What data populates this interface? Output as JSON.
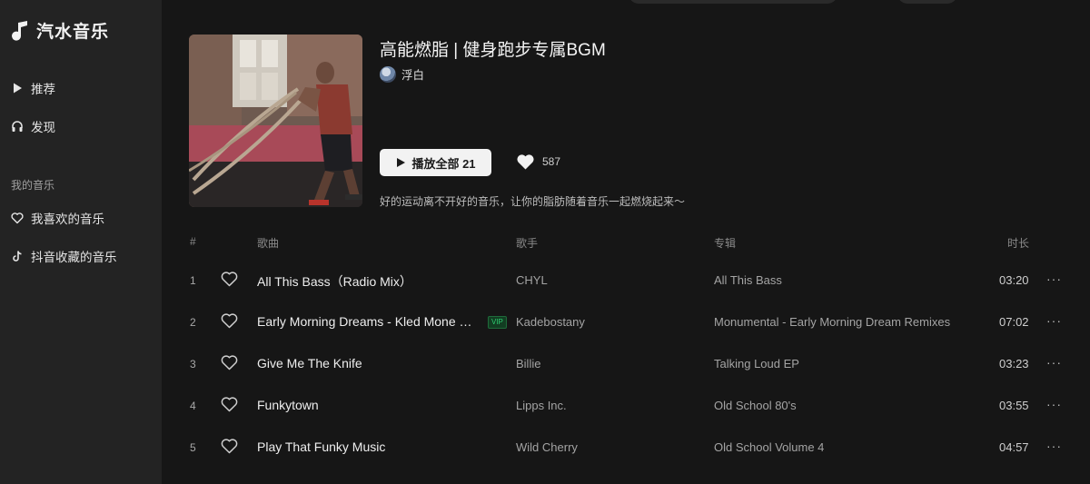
{
  "app": {
    "name": "汽水音乐"
  },
  "sidebar": {
    "items": [
      {
        "label": "推荐",
        "icon": "play-icon"
      },
      {
        "label": "发现",
        "icon": "headphones-icon"
      }
    ],
    "section_label": "我的音乐",
    "my_items": [
      {
        "label": "我喜欢的音乐",
        "icon": "heart-icon"
      },
      {
        "label": "抖音收藏的音乐",
        "icon": "tiktok-icon"
      }
    ]
  },
  "playlist": {
    "title": "高能燃脂 | 健身跑步专属BGM",
    "creator": "浮白",
    "play_all_label": "播放全部 21",
    "like_count": "587",
    "description": "好的运动离不开好的音乐，让你的脂肪随着音乐一起燃烧起来～"
  },
  "table": {
    "headers": {
      "index": "#",
      "title": "歌曲",
      "artist": "歌手",
      "album": "专辑",
      "duration": "时长"
    },
    "rows": [
      {
        "index": "1",
        "title": "All This Bass（Radio Mix）",
        "vip": "",
        "artist": "CHYL",
        "album": "All This Bass",
        "duration": "03:20"
      },
      {
        "index": "2",
        "title": "Early Morning Dreams - Kled Mone Remix",
        "vip": "VIP",
        "artist": "Kadebostany",
        "album": "Monumental - Early Morning Dream Remixes",
        "duration": "07:02"
      },
      {
        "index": "3",
        "title": "Give Me The Knife",
        "vip": "",
        "artist": "Billie",
        "album": "Talking Loud EP",
        "duration": "03:23"
      },
      {
        "index": "4",
        "title": "Funkytown",
        "vip": "",
        "artist": "Lipps Inc.",
        "album": "Old School 80's",
        "duration": "03:55"
      },
      {
        "index": "5",
        "title": "Play That Funky Music",
        "vip": "",
        "artist": "Wild Cherry",
        "album": "Old School Volume 4",
        "duration": "04:57"
      }
    ]
  },
  "colors": {
    "background": "#161616",
    "sidebar": "#232323",
    "vip_green": "#2ecc71"
  }
}
